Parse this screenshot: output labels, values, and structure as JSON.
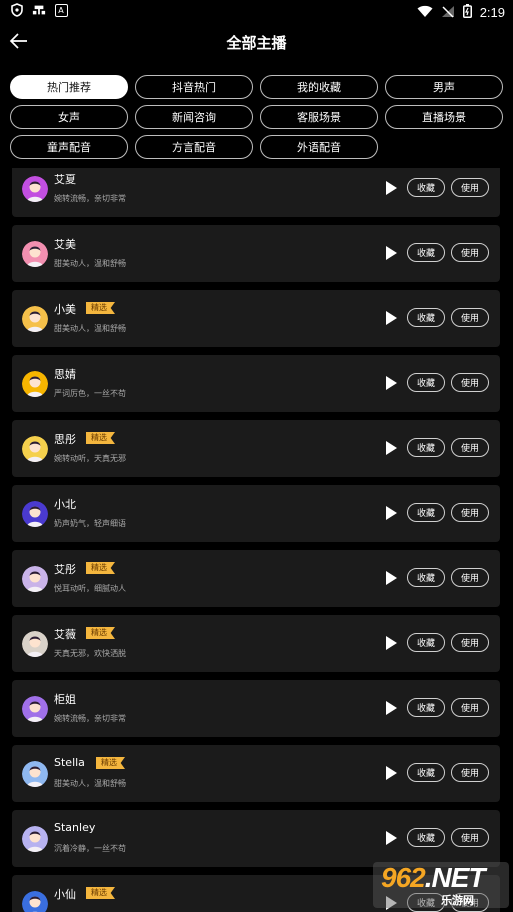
{
  "status_bar": {
    "time": "2:19",
    "left_icons": [
      "shield-icon",
      "game-icon",
      "a-box-icon"
    ],
    "right_icons": [
      "wifi-icon",
      "no-signal-icon",
      "battery-icon"
    ]
  },
  "header": {
    "title": "全部主播"
  },
  "filters": [
    {
      "label": "热门推荐",
      "active": true
    },
    {
      "label": "抖音热门"
    },
    {
      "label": "我的收藏"
    },
    {
      "label": "男声"
    },
    {
      "label": "女声"
    },
    {
      "label": "新闻咨询"
    },
    {
      "label": "客服场景"
    },
    {
      "label": "直播场景"
    },
    {
      "label": "童声配音"
    },
    {
      "label": "方言配音"
    },
    {
      "label": "外语配音"
    }
  ],
  "voices": [
    {
      "name": "艾夏",
      "desc": "婉转流畅，亲切非常",
      "featured": false,
      "avatar_color": "#c24fe0"
    },
    {
      "name": "艾美",
      "desc": "甜美动人，温和舒畅",
      "featured": false,
      "avatar_color": "#f28fb0"
    },
    {
      "name": "小美",
      "desc": "甜美动人，温和舒畅",
      "featured": true,
      "avatar_color": "#f5c04a"
    },
    {
      "name": "思婧",
      "desc": "严词厉色，一丝不苟",
      "featured": false,
      "avatar_color": "#f7b500"
    },
    {
      "name": "思彤",
      "desc": "婉转动听，天真无邪",
      "featured": true,
      "avatar_color": "#f5d04d"
    },
    {
      "name": "小北",
      "desc": "奶声奶气，轻声细语",
      "featured": false,
      "avatar_color": "#4a3ad0"
    },
    {
      "name": "艾彤",
      "desc": "悦耳动听，细腻动人",
      "featured": true,
      "avatar_color": "#c9b3e8"
    },
    {
      "name": "艾薇",
      "desc": "天真无邪，欢快洒脱",
      "featured": true,
      "avatar_color": "#d9d2c9"
    },
    {
      "name": "柜姐",
      "desc": "婉转流畅，亲切非常",
      "featured": false,
      "avatar_color": "#a070e8"
    },
    {
      "name": "Stella",
      "desc": "甜美动人，温和舒畅",
      "featured": true,
      "avatar_color": "#8fb8f0"
    },
    {
      "name": "Stanley",
      "desc": "沉着冷静，一丝不苟",
      "featured": false,
      "avatar_color": "#b7b2f0"
    },
    {
      "name": "小仙",
      "desc": "",
      "featured": true,
      "avatar_color": "#3a6fe0"
    }
  ],
  "labels": {
    "featured": "精选",
    "favorite": "收藏",
    "use": "使用"
  },
  "watermark": {
    "text_orange": "962",
    "text_white": ".NET",
    "subtitle": "乐游网"
  }
}
